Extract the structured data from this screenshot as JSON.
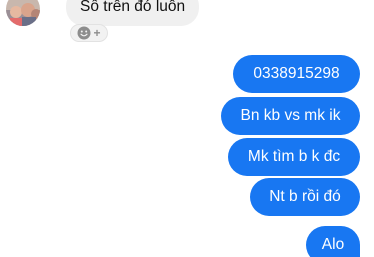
{
  "conversation": {
    "incoming": {
      "text": "Số trên đó luôn",
      "reaction_button": {
        "icon": "smiley-add-icon",
        "plus": "+"
      }
    },
    "outgoing": [
      {
        "text": "0338915298"
      },
      {
        "text": "Bn kb vs mk ik"
      },
      {
        "text": "Mk tìm b k đc"
      },
      {
        "text": "Nt b rồi đó"
      },
      {
        "text": "Alo"
      }
    ]
  },
  "colors": {
    "outgoing_bubble": "#1877f2",
    "incoming_bubble": "#f0f0f0",
    "reaction_icon": "#8d8d8d"
  }
}
